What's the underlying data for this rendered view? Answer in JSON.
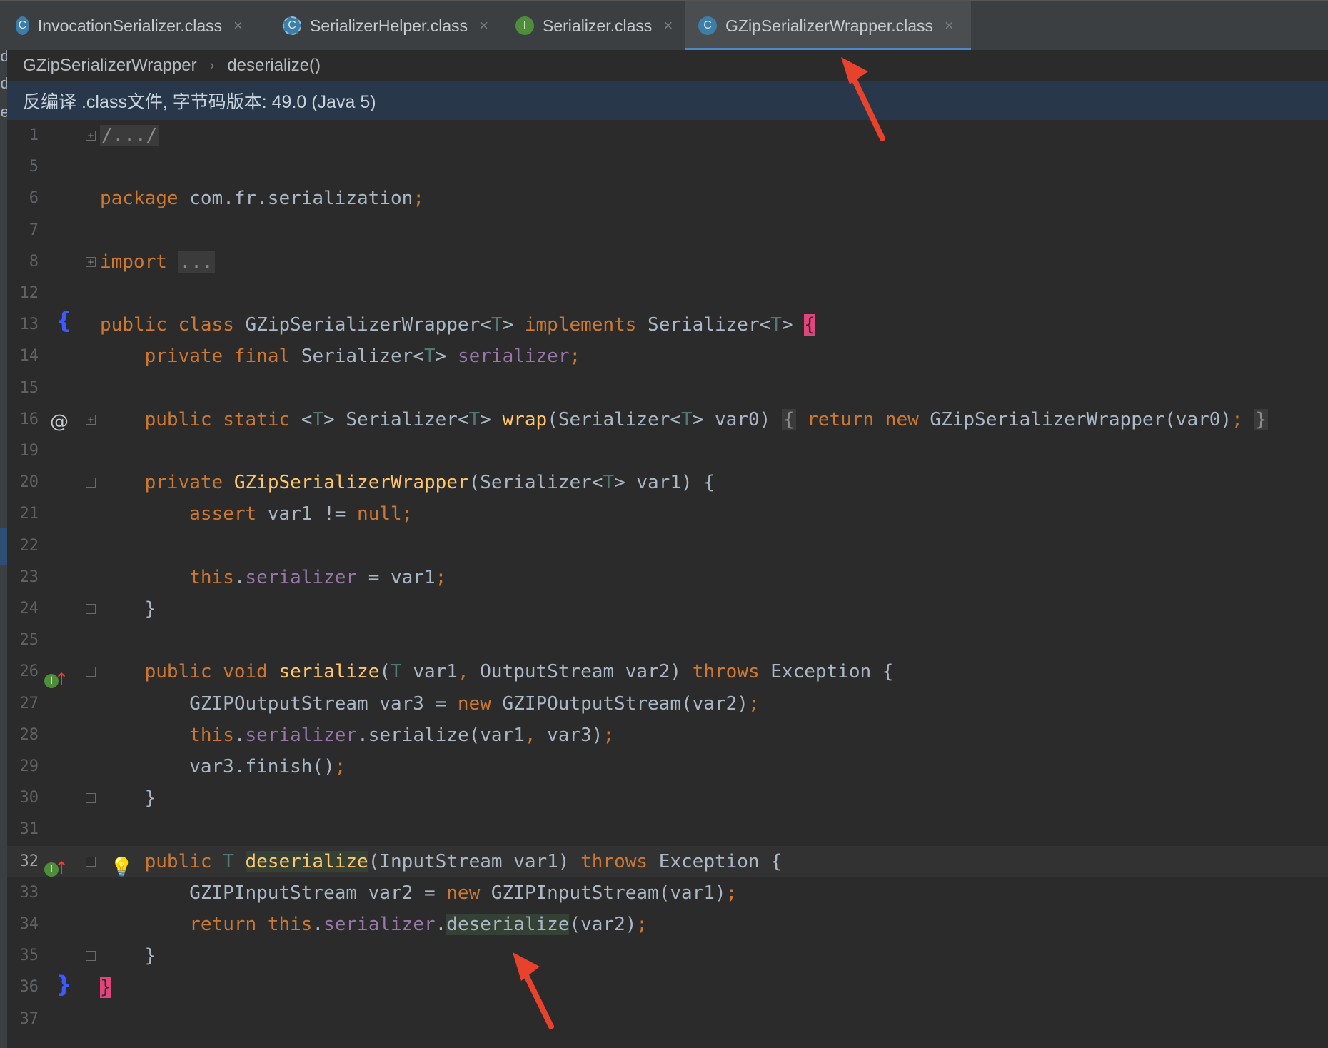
{
  "tabs": [
    {
      "label": "InvocationSerializer.class",
      "icon": "c",
      "close": "×"
    },
    {
      "label": "SerializerHelper.class",
      "icon": "ca",
      "close": "×"
    },
    {
      "label": "Serializer.class",
      "icon": "i",
      "close": "×"
    },
    {
      "label": "GZipSerializerWrapper.class",
      "icon": "c",
      "close": "×",
      "active": true
    }
  ],
  "tab_icon_letters": {
    "c": "C",
    "i": "I",
    "ca": "C"
  },
  "left_strip_chars": [
    "d",
    "d",
    "e"
  ],
  "breadcrumb": {
    "class_name": "GZipSerializerWrapper",
    "method": "deserialize()",
    "sep": "›"
  },
  "banner": {
    "text": "反编译 .class文件, 字节码版本: 49.0 (Java 5)"
  },
  "line_numbers": [
    "1",
    "5",
    "6",
    "7",
    "8",
    "12",
    "13",
    "14",
    "15",
    "16",
    "19",
    "20",
    "21",
    "22",
    "23",
    "24",
    "25",
    "26",
    "27",
    "28",
    "29",
    "30",
    "31",
    "32",
    "33",
    "34",
    "35",
    "36",
    "37"
  ],
  "current_line": "32",
  "gutter": {
    "brace_open": "{",
    "brace_close": "}",
    "at": "@",
    "impl_i": "I",
    "impl_arrow": "↑",
    "bulb": "💡"
  },
  "code_lines": [
    "/.../",
    "",
    "package com.fr.serialization;",
    "",
    "import ...",
    "",
    "public class GZipSerializerWrapper<T> implements Serializer<T> {",
    "    private final Serializer<T> serializer;",
    "",
    "    public static <T> Serializer<T> wrap(Serializer<T> var0) { return new GZipSerializerWrapper(var0); }",
    "",
    "    private GZipSerializerWrapper(Serializer<T> var1) {",
    "        assert var1 != null;",
    "",
    "        this.serializer = var1;",
    "    }",
    "",
    "    public void serialize(T var1, OutputStream var2) throws Exception {",
    "        GZIPOutputStream var3 = new GZIPOutputStream(var2);",
    "        this.serializer.serialize(var1, var3);",
    "        var3.finish();",
    "    }",
    "",
    "    public T deserialize(InputStream var1) throws Exception {",
    "        GZIPInputStream var2 = new GZIPInputStream(var1);",
    "        return this.serializer.deserialize(var2);",
    "    }",
    "}",
    ""
  ],
  "colors": {
    "keyword": "#cc7832",
    "function": "#ffc66d",
    "field": "#9876aa",
    "type_param": "#507874",
    "annotation_arrow": "#e8412c",
    "accent_tab": "#4a88c7"
  }
}
